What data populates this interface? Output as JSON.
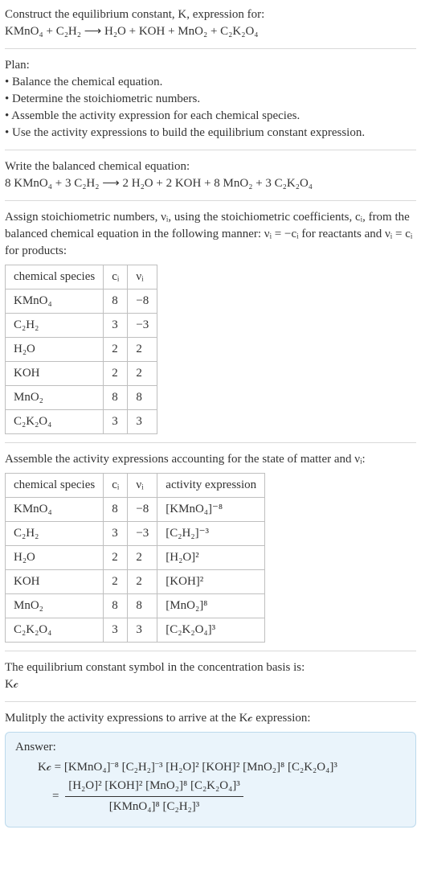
{
  "intro": {
    "line1": "Construct the equilibrium constant, K, expression for:",
    "equation_unbalanced": "KMnO₄ + C₂H₂ ⟶ H₂O + KOH + MnO₂ + C₂K₂O₄"
  },
  "plan": {
    "heading": "Plan:",
    "bullets": [
      "• Balance the chemical equation.",
      "• Determine the stoichiometric numbers.",
      "• Assemble the activity expression for each chemical species.",
      "• Use the activity expressions to build the equilibrium constant expression."
    ]
  },
  "balanced": {
    "heading": "Write the balanced chemical equation:",
    "equation": "8 KMnO₄ + 3 C₂H₂ ⟶ 2 H₂O + 2 KOH + 8 MnO₂ + 3 C₂K₂O₄"
  },
  "stoich_text": "Assign stoichiometric numbers, νᵢ, using the stoichiometric coefficients, cᵢ, from the balanced chemical equation in the following manner: νᵢ = −cᵢ for reactants and νᵢ = cᵢ for products:",
  "table1": {
    "headers": [
      "chemical species",
      "cᵢ",
      "νᵢ"
    ],
    "rows": [
      [
        "KMnO₄",
        "8",
        "−8"
      ],
      [
        "C₂H₂",
        "3",
        "−3"
      ],
      [
        "H₂O",
        "2",
        "2"
      ],
      [
        "KOH",
        "2",
        "2"
      ],
      [
        "MnO₂",
        "8",
        "8"
      ],
      [
        "C₂K₂O₄",
        "3",
        "3"
      ]
    ]
  },
  "activity_text": "Assemble the activity expressions accounting for the state of matter and νᵢ:",
  "table2": {
    "headers": [
      "chemical species",
      "cᵢ",
      "νᵢ",
      "activity expression"
    ],
    "rows": [
      [
        "KMnO₄",
        "8",
        "−8",
        "[KMnO₄]⁻⁸"
      ],
      [
        "C₂H₂",
        "3",
        "−3",
        "[C₂H₂]⁻³"
      ],
      [
        "H₂O",
        "2",
        "2",
        "[H₂O]²"
      ],
      [
        "KOH",
        "2",
        "2",
        "[KOH]²"
      ],
      [
        "MnO₂",
        "8",
        "8",
        "[MnO₂]⁸"
      ],
      [
        "C₂K₂O₄",
        "3",
        "3",
        "[C₂K₂O₄]³"
      ]
    ]
  },
  "kc_text": {
    "line1": "The equilibrium constant symbol in the concentration basis is:",
    "symbol": "K𝒸"
  },
  "multiply_text": "Mulitply the activity expressions to arrive at the K𝒸 expression:",
  "answer": {
    "label": "Answer:",
    "expr_flat": "K𝒸 = [KMnO₄]⁻⁸ [C₂H₂]⁻³ [H₂O]² [KOH]² [MnO₂]⁸ [C₂K₂O₄]³",
    "eq_sign": "= ",
    "frac_num": "[H₂O]² [KOH]² [MnO₂]⁸ [C₂K₂O₄]³",
    "frac_den": "[KMnO₄]⁸ [C₂H₂]³"
  }
}
